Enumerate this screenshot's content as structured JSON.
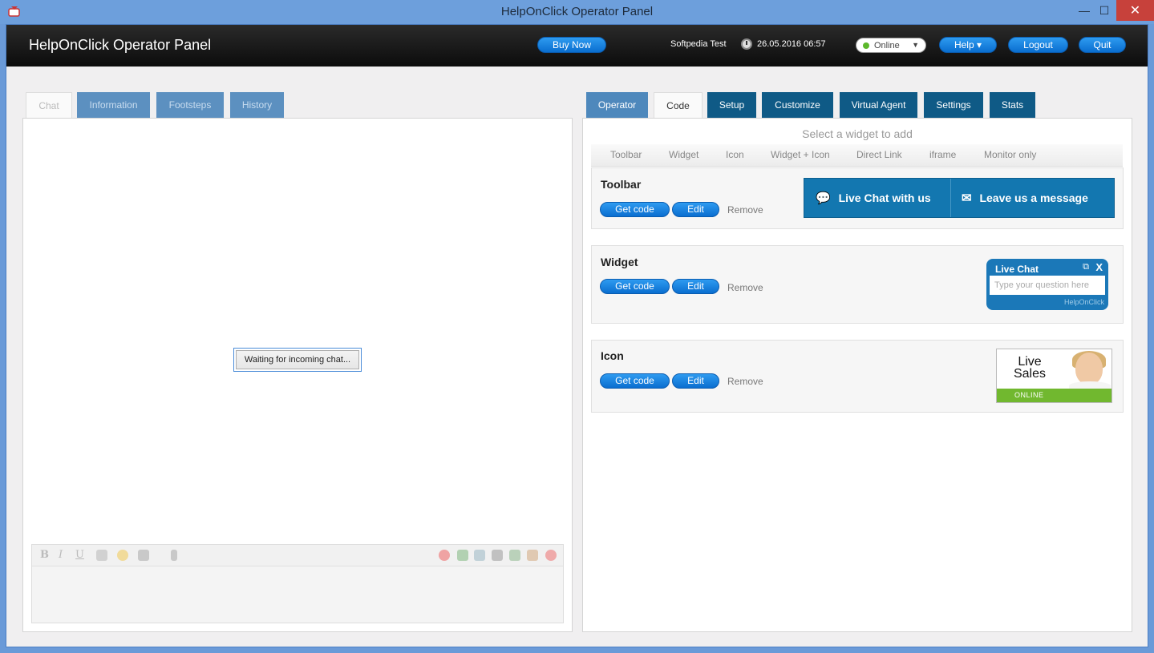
{
  "window": {
    "title": "HelpOnClick Operator Panel",
    "min": "—",
    "max": "☐",
    "close": "✕"
  },
  "header": {
    "brand": "HelpOnClick Operator Panel",
    "buy_now": "Buy Now",
    "user": "Softpedia Test",
    "datetime": "26.05.2016 06:57",
    "status": "Online",
    "help": "Help ▾",
    "logout": "Logout",
    "quit": "Quit"
  },
  "left_tabs": [
    "Chat",
    "Information",
    "Footsteps",
    "History"
  ],
  "chat": {
    "waiting": "Waiting for incoming chat...",
    "format": {
      "bold": "B",
      "italic": "I",
      "underline": "U"
    }
  },
  "right_tabs": [
    "Operator",
    "Code",
    "Setup",
    "Customize",
    "Virtual Agent",
    "Settings",
    "Stats"
  ],
  "code": {
    "select_title": "Select a widget to add",
    "subnav": [
      "Toolbar",
      "Widget",
      "Icon",
      "Widget + Icon",
      "Direct Link",
      "iframe",
      "Monitor only"
    ],
    "get_code": "Get code",
    "edit": "Edit",
    "remove": "Remove",
    "cards": {
      "toolbar": {
        "title": "Toolbar",
        "live_chat": "Live Chat with us",
        "leave_message": "Leave us a message"
      },
      "widget": {
        "title": "Widget",
        "header": "Live Chat",
        "placeholder": "Type your question here",
        "brand": "HelpOnClick",
        "close": "X",
        "popout": "⧉"
      },
      "icon": {
        "title": "Icon",
        "line1": "Live",
        "line2": "Sales",
        "status": "ONLINE"
      }
    }
  },
  "colors": {
    "accent": "#1377b0",
    "tab_dark": "#0f5a86",
    "online": "#5cb82c"
  }
}
